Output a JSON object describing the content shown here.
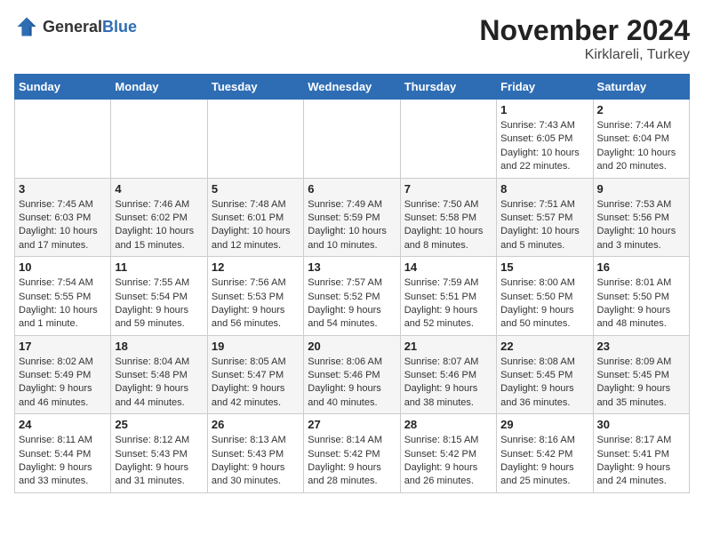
{
  "logo": {
    "general": "General",
    "blue": "Blue"
  },
  "title": {
    "month": "November 2024",
    "location": "Kirklareli, Turkey"
  },
  "days_of_week": [
    "Sunday",
    "Monday",
    "Tuesday",
    "Wednesday",
    "Thursday",
    "Friday",
    "Saturday"
  ],
  "weeks": [
    [
      {
        "day": "",
        "info": ""
      },
      {
        "day": "",
        "info": ""
      },
      {
        "day": "",
        "info": ""
      },
      {
        "day": "",
        "info": ""
      },
      {
        "day": "",
        "info": ""
      },
      {
        "day": "1",
        "info": "Sunrise: 7:43 AM\nSunset: 6:05 PM\nDaylight: 10 hours and 22 minutes."
      },
      {
        "day": "2",
        "info": "Sunrise: 7:44 AM\nSunset: 6:04 PM\nDaylight: 10 hours and 20 minutes."
      }
    ],
    [
      {
        "day": "3",
        "info": "Sunrise: 7:45 AM\nSunset: 6:03 PM\nDaylight: 10 hours and 17 minutes."
      },
      {
        "day": "4",
        "info": "Sunrise: 7:46 AM\nSunset: 6:02 PM\nDaylight: 10 hours and 15 minutes."
      },
      {
        "day": "5",
        "info": "Sunrise: 7:48 AM\nSunset: 6:01 PM\nDaylight: 10 hours and 12 minutes."
      },
      {
        "day": "6",
        "info": "Sunrise: 7:49 AM\nSunset: 5:59 PM\nDaylight: 10 hours and 10 minutes."
      },
      {
        "day": "7",
        "info": "Sunrise: 7:50 AM\nSunset: 5:58 PM\nDaylight: 10 hours and 8 minutes."
      },
      {
        "day": "8",
        "info": "Sunrise: 7:51 AM\nSunset: 5:57 PM\nDaylight: 10 hours and 5 minutes."
      },
      {
        "day": "9",
        "info": "Sunrise: 7:53 AM\nSunset: 5:56 PM\nDaylight: 10 hours and 3 minutes."
      }
    ],
    [
      {
        "day": "10",
        "info": "Sunrise: 7:54 AM\nSunset: 5:55 PM\nDaylight: 10 hours and 1 minute."
      },
      {
        "day": "11",
        "info": "Sunrise: 7:55 AM\nSunset: 5:54 PM\nDaylight: 9 hours and 59 minutes."
      },
      {
        "day": "12",
        "info": "Sunrise: 7:56 AM\nSunset: 5:53 PM\nDaylight: 9 hours and 56 minutes."
      },
      {
        "day": "13",
        "info": "Sunrise: 7:57 AM\nSunset: 5:52 PM\nDaylight: 9 hours and 54 minutes."
      },
      {
        "day": "14",
        "info": "Sunrise: 7:59 AM\nSunset: 5:51 PM\nDaylight: 9 hours and 52 minutes."
      },
      {
        "day": "15",
        "info": "Sunrise: 8:00 AM\nSunset: 5:50 PM\nDaylight: 9 hours and 50 minutes."
      },
      {
        "day": "16",
        "info": "Sunrise: 8:01 AM\nSunset: 5:50 PM\nDaylight: 9 hours and 48 minutes."
      }
    ],
    [
      {
        "day": "17",
        "info": "Sunrise: 8:02 AM\nSunset: 5:49 PM\nDaylight: 9 hours and 46 minutes."
      },
      {
        "day": "18",
        "info": "Sunrise: 8:04 AM\nSunset: 5:48 PM\nDaylight: 9 hours and 44 minutes."
      },
      {
        "day": "19",
        "info": "Sunrise: 8:05 AM\nSunset: 5:47 PM\nDaylight: 9 hours and 42 minutes."
      },
      {
        "day": "20",
        "info": "Sunrise: 8:06 AM\nSunset: 5:46 PM\nDaylight: 9 hours and 40 minutes."
      },
      {
        "day": "21",
        "info": "Sunrise: 8:07 AM\nSunset: 5:46 PM\nDaylight: 9 hours and 38 minutes."
      },
      {
        "day": "22",
        "info": "Sunrise: 8:08 AM\nSunset: 5:45 PM\nDaylight: 9 hours and 36 minutes."
      },
      {
        "day": "23",
        "info": "Sunrise: 8:09 AM\nSunset: 5:45 PM\nDaylight: 9 hours and 35 minutes."
      }
    ],
    [
      {
        "day": "24",
        "info": "Sunrise: 8:11 AM\nSunset: 5:44 PM\nDaylight: 9 hours and 33 minutes."
      },
      {
        "day": "25",
        "info": "Sunrise: 8:12 AM\nSunset: 5:43 PM\nDaylight: 9 hours and 31 minutes."
      },
      {
        "day": "26",
        "info": "Sunrise: 8:13 AM\nSunset: 5:43 PM\nDaylight: 9 hours and 30 minutes."
      },
      {
        "day": "27",
        "info": "Sunrise: 8:14 AM\nSunset: 5:42 PM\nDaylight: 9 hours and 28 minutes."
      },
      {
        "day": "28",
        "info": "Sunrise: 8:15 AM\nSunset: 5:42 PM\nDaylight: 9 hours and 26 minutes."
      },
      {
        "day": "29",
        "info": "Sunrise: 8:16 AM\nSunset: 5:42 PM\nDaylight: 9 hours and 25 minutes."
      },
      {
        "day": "30",
        "info": "Sunrise: 8:17 AM\nSunset: 5:41 PM\nDaylight: 9 hours and 24 minutes."
      }
    ]
  ]
}
